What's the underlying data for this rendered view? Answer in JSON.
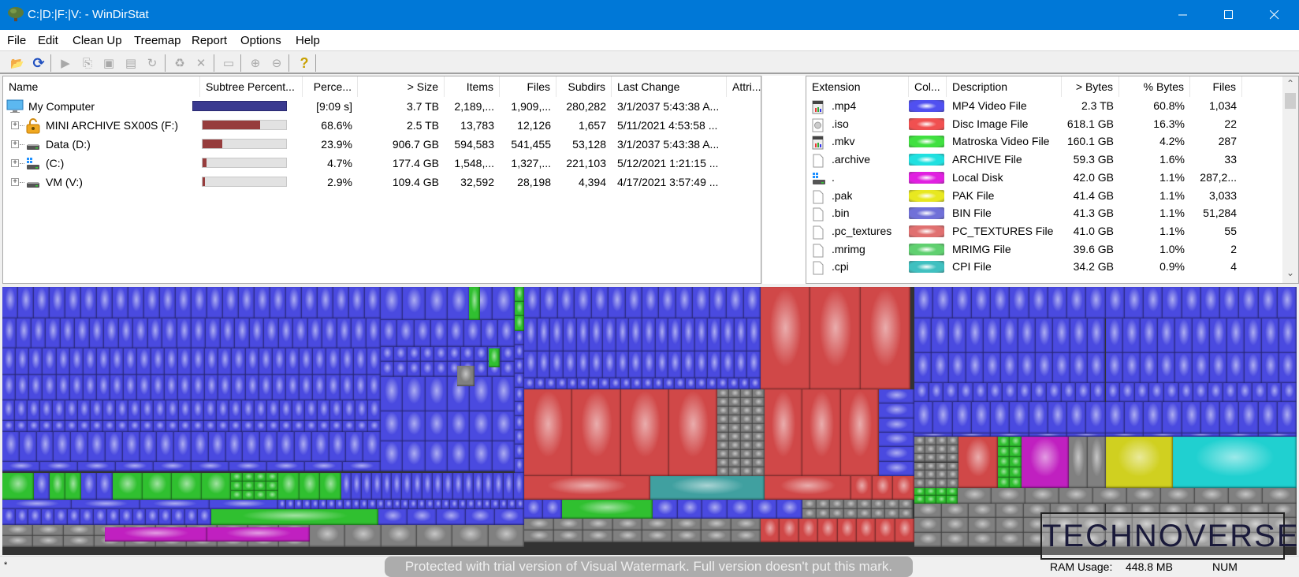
{
  "window": {
    "title": "C:|D:|F:|V: - WinDirStat",
    "app_icon": "windirstat-tree-icon",
    "controls": [
      "minimize-icon",
      "maximize-icon",
      "close-icon"
    ]
  },
  "menu": [
    "File",
    "Edit",
    "Clean Up",
    "Treemap",
    "Report",
    "Options",
    "Help"
  ],
  "toolbar": [
    {
      "name": "open-icon",
      "glyph": "📂",
      "enabled": true
    },
    {
      "name": "refresh-icon",
      "glyph": "⟳",
      "enabled": true
    },
    {
      "name": "play-icon",
      "glyph": "▶",
      "enabled": false
    },
    {
      "name": "copy-path-icon",
      "glyph": "⎘",
      "enabled": false
    },
    {
      "name": "explorer-icon",
      "glyph": "▣",
      "enabled": false
    },
    {
      "name": "command-prompt-icon",
      "glyph": "▤",
      "enabled": false
    },
    {
      "name": "refresh-selected-icon",
      "glyph": "↻",
      "enabled": false
    },
    {
      "name": "recycle-bin-icon",
      "glyph": "♻",
      "enabled": false
    },
    {
      "name": "delete-icon",
      "glyph": "✕",
      "enabled": false
    },
    {
      "name": "properties-icon",
      "glyph": "▭",
      "enabled": false
    },
    {
      "name": "zoom-in-icon",
      "glyph": "⊕",
      "enabled": false
    },
    {
      "name": "zoom-out-icon",
      "glyph": "⊖",
      "enabled": false
    },
    {
      "name": "help-icon",
      "glyph": "?",
      "enabled": true
    }
  ],
  "dir_tree": {
    "columns": [
      "Name",
      "Subtree Percent...",
      "Perce...",
      "> Size",
      "Items",
      "Files",
      "Subdirs",
      "Last Change",
      "Attri..."
    ],
    "rows": [
      {
        "name": "My Computer",
        "icon": "computer-icon",
        "expandable": false,
        "subtree_fraction": 1.0,
        "percent": "[9:09 s]",
        "size": "3.7 TB",
        "items": "2,189,...",
        "files": "1,909,...",
        "subdirs": "280,282",
        "last_change": "3/1/2037  5:43:38 A...",
        "attributes": ""
      },
      {
        "name": "MINI ARCHIVE SX00S (F:)",
        "icon": "locked-drive-icon",
        "expandable": true,
        "subtree_fraction": 0.686,
        "percent": "68.6%",
        "size": "2.5 TB",
        "items": "13,783",
        "files": "12,126",
        "subdirs": "1,657",
        "last_change": "5/11/2021  4:53:58 ...",
        "attributes": ""
      },
      {
        "name": "Data (D:)",
        "icon": "drive-icon",
        "expandable": true,
        "subtree_fraction": 0.239,
        "percent": "23.9%",
        "size": "906.7 GB",
        "items": "594,583",
        "files": "541,455",
        "subdirs": "53,128",
        "last_change": "3/1/2037  5:43:38 A...",
        "attributes": ""
      },
      {
        "name": " (C:)",
        "icon": "windows-drive-icon",
        "expandable": true,
        "subtree_fraction": 0.047,
        "percent": "4.7%",
        "size": "177.4 GB",
        "items": "1,548,...",
        "files": "1,327,...",
        "subdirs": "221,103",
        "last_change": "5/12/2021  1:21:15 ...",
        "attributes": ""
      },
      {
        "name": "VM (V:)",
        "icon": "drive-icon",
        "expandable": true,
        "subtree_fraction": 0.029,
        "percent": "2.9%",
        "size": "109.4 GB",
        "items": "32,592",
        "files": "28,198",
        "subdirs": "4,394",
        "last_change": "4/17/2021  3:57:49 ...",
        "attributes": ""
      }
    ]
  },
  "extensions": {
    "columns": [
      "Extension",
      "Col...",
      "Description",
      "> Bytes",
      "% Bytes",
      "Files"
    ],
    "rows": [
      {
        "ext": ".mp4",
        "icon": "video-file-icon",
        "color": "#5050f0",
        "description": "MP4 Video File",
        "bytes": "2.3 TB",
        "pct": "60.8%",
        "files": "1,034"
      },
      {
        "ext": ".iso",
        "icon": "disc-image-icon",
        "color": "#f05050",
        "description": "Disc Image File",
        "bytes": "618.1 GB",
        "pct": "16.3%",
        "files": "22"
      },
      {
        "ext": ".mkv",
        "icon": "video-file-icon",
        "color": "#40e040",
        "description": "Matroska Video File",
        "bytes": "160.1 GB",
        "pct": "4.2%",
        "files": "287"
      },
      {
        "ext": ".archive",
        "icon": "file-icon",
        "color": "#20e0e0",
        "description": "ARCHIVE File",
        "bytes": "59.3 GB",
        "pct": "1.6%",
        "files": "33"
      },
      {
        "ext": ".",
        "icon": "windows-drive-icon",
        "color": "#e020e0",
        "description": "Local Disk",
        "bytes": "42.0 GB",
        "pct": "1.1%",
        "files": "287,2..."
      },
      {
        "ext": ".pak",
        "icon": "file-icon",
        "color": "#e8e820",
        "description": "PAK File",
        "bytes": "41.4 GB",
        "pct": "1.1%",
        "files": "3,033"
      },
      {
        "ext": ".bin",
        "icon": "file-icon",
        "color": "#7070d8",
        "description": "BIN File",
        "bytes": "41.3 GB",
        "pct": "1.1%",
        "files": "51,284"
      },
      {
        "ext": ".pc_textures",
        "icon": "file-icon",
        "color": "#e07070",
        "description": "PC_TEXTURES File",
        "bytes": "41.0 GB",
        "pct": "1.1%",
        "files": "55"
      },
      {
        "ext": ".mrimg",
        "icon": "file-icon",
        "color": "#60d070",
        "description": "MRIMG File",
        "bytes": "39.6 GB",
        "pct": "1.0%",
        "files": "2"
      },
      {
        "ext": ".cpi",
        "icon": "file-icon",
        "color": "#40c0c0",
        "description": "CPI File",
        "bytes": "34.2 GB",
        "pct": "0.9%",
        "files": "4"
      }
    ]
  },
  "treemap": {
    "colors": {
      "mp4": "#4a4ae0",
      "iso": "#d04848",
      "mkv": "#30c030",
      "archive": "#20d0d0",
      "local": "#c020c0",
      "pak": "#d0d020",
      "other": "#808080",
      "cpi": "#40a0a0"
    }
  },
  "status": {
    "left": "*",
    "ram_label": "RAM Usage:",
    "ram_value": "448.8 MB",
    "num": "NUM"
  },
  "overlays": {
    "watermark": "Protected with trial version of Visual Watermark. Full version doesn't put this mark.",
    "logo": "TECHNOVERSE"
  }
}
